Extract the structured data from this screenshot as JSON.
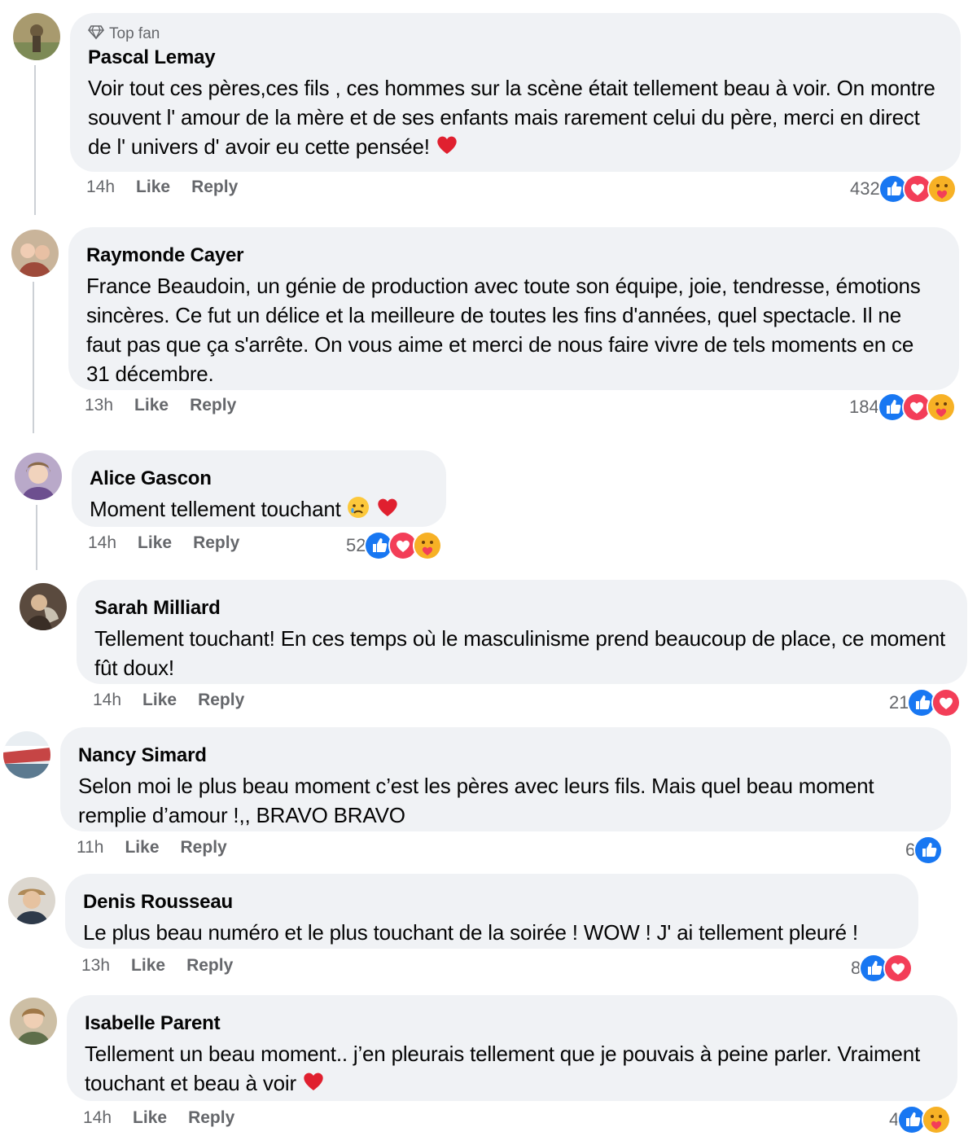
{
  "comments": [
    {
      "badge": "Top fan",
      "author": "Pascal Lemay",
      "text": "Voir tout ces pères,ces fils , ces hommes sur la scène était tellement beau à voir. On montre souvent l' amour de la mère et de ses enfants mais rarement celui du père, merci en direct de l' univers d' avoir eu cette pensée!",
      "time": "14h",
      "like": "Like",
      "reply": "Reply",
      "reaction_count": "432",
      "reactions": [
        "like-icon",
        "love-icon",
        "care-icon"
      ],
      "trailing_emoji": [
        "red-heart-emoji"
      ]
    },
    {
      "author": "Raymonde Cayer",
      "text": "France Beaudoin, un génie de production avec toute son équipe, joie, tendresse, émotions sincères. Ce fut un délice et la meilleure de toutes les fins d'années, quel spectacle. Il ne faut pas que ça s'arrête. On vous aime et merci de nous faire vivre de tels moments en ce 31 décembre.",
      "time": "13h",
      "like": "Like",
      "reply": "Reply",
      "reaction_count": "184",
      "reactions": [
        "like-icon",
        "love-icon",
        "care-icon"
      ]
    },
    {
      "author": "Alice Gascon",
      "text": "Moment tellement touchant",
      "time": "14h",
      "like": "Like",
      "reply": "Reply",
      "reaction_count": "52",
      "reactions": [
        "like-icon",
        "love-icon",
        "care-icon"
      ],
      "trailing_emoji": [
        "crying-face-emoji",
        "red-heart-emoji"
      ]
    },
    {
      "author": "Sarah Milliard",
      "text": "Tellement touchant! En ces temps où le masculinisme prend beaucoup de place, ce moment fût doux!",
      "time": "14h",
      "like": "Like",
      "reply": "Reply",
      "reaction_count": "21",
      "reactions": [
        "like-icon",
        "love-icon"
      ]
    },
    {
      "author": "Nancy Simard",
      "text": "Selon moi le plus beau moment c’est les pères avec leurs fils. Mais quel beau moment remplie d’amour !,, BRAVO BRAVO",
      "time": "11h",
      "like": "Like",
      "reply": "Reply",
      "reaction_count": "6",
      "reactions": [
        "like-icon"
      ]
    },
    {
      "author": "Denis Rousseau",
      "text": "Le plus beau numéro et le plus touchant de la soirée ! WOW ! J' ai tellement pleuré !",
      "time": "13h",
      "like": "Like",
      "reply": "Reply",
      "reaction_count": "8",
      "reactions": [
        "like-icon",
        "love-icon"
      ]
    },
    {
      "author": "Isabelle Parent",
      "text": "Tellement un beau moment.. j’en pleurais tellement que je pouvais à peine parler. Vraiment touchant et beau à voir",
      "time": "14h",
      "like": "Like",
      "reply": "Reply",
      "reaction_count": "4",
      "reactions": [
        "like-icon",
        "care-icon"
      ],
      "trailing_emoji": [
        "red-heart-emoji"
      ]
    }
  ],
  "colors": {
    "bubble": "#f0f2f5",
    "like": "#1877f2",
    "love": "#f33e58",
    "care": "#f7b125",
    "meta": "#65676b"
  }
}
